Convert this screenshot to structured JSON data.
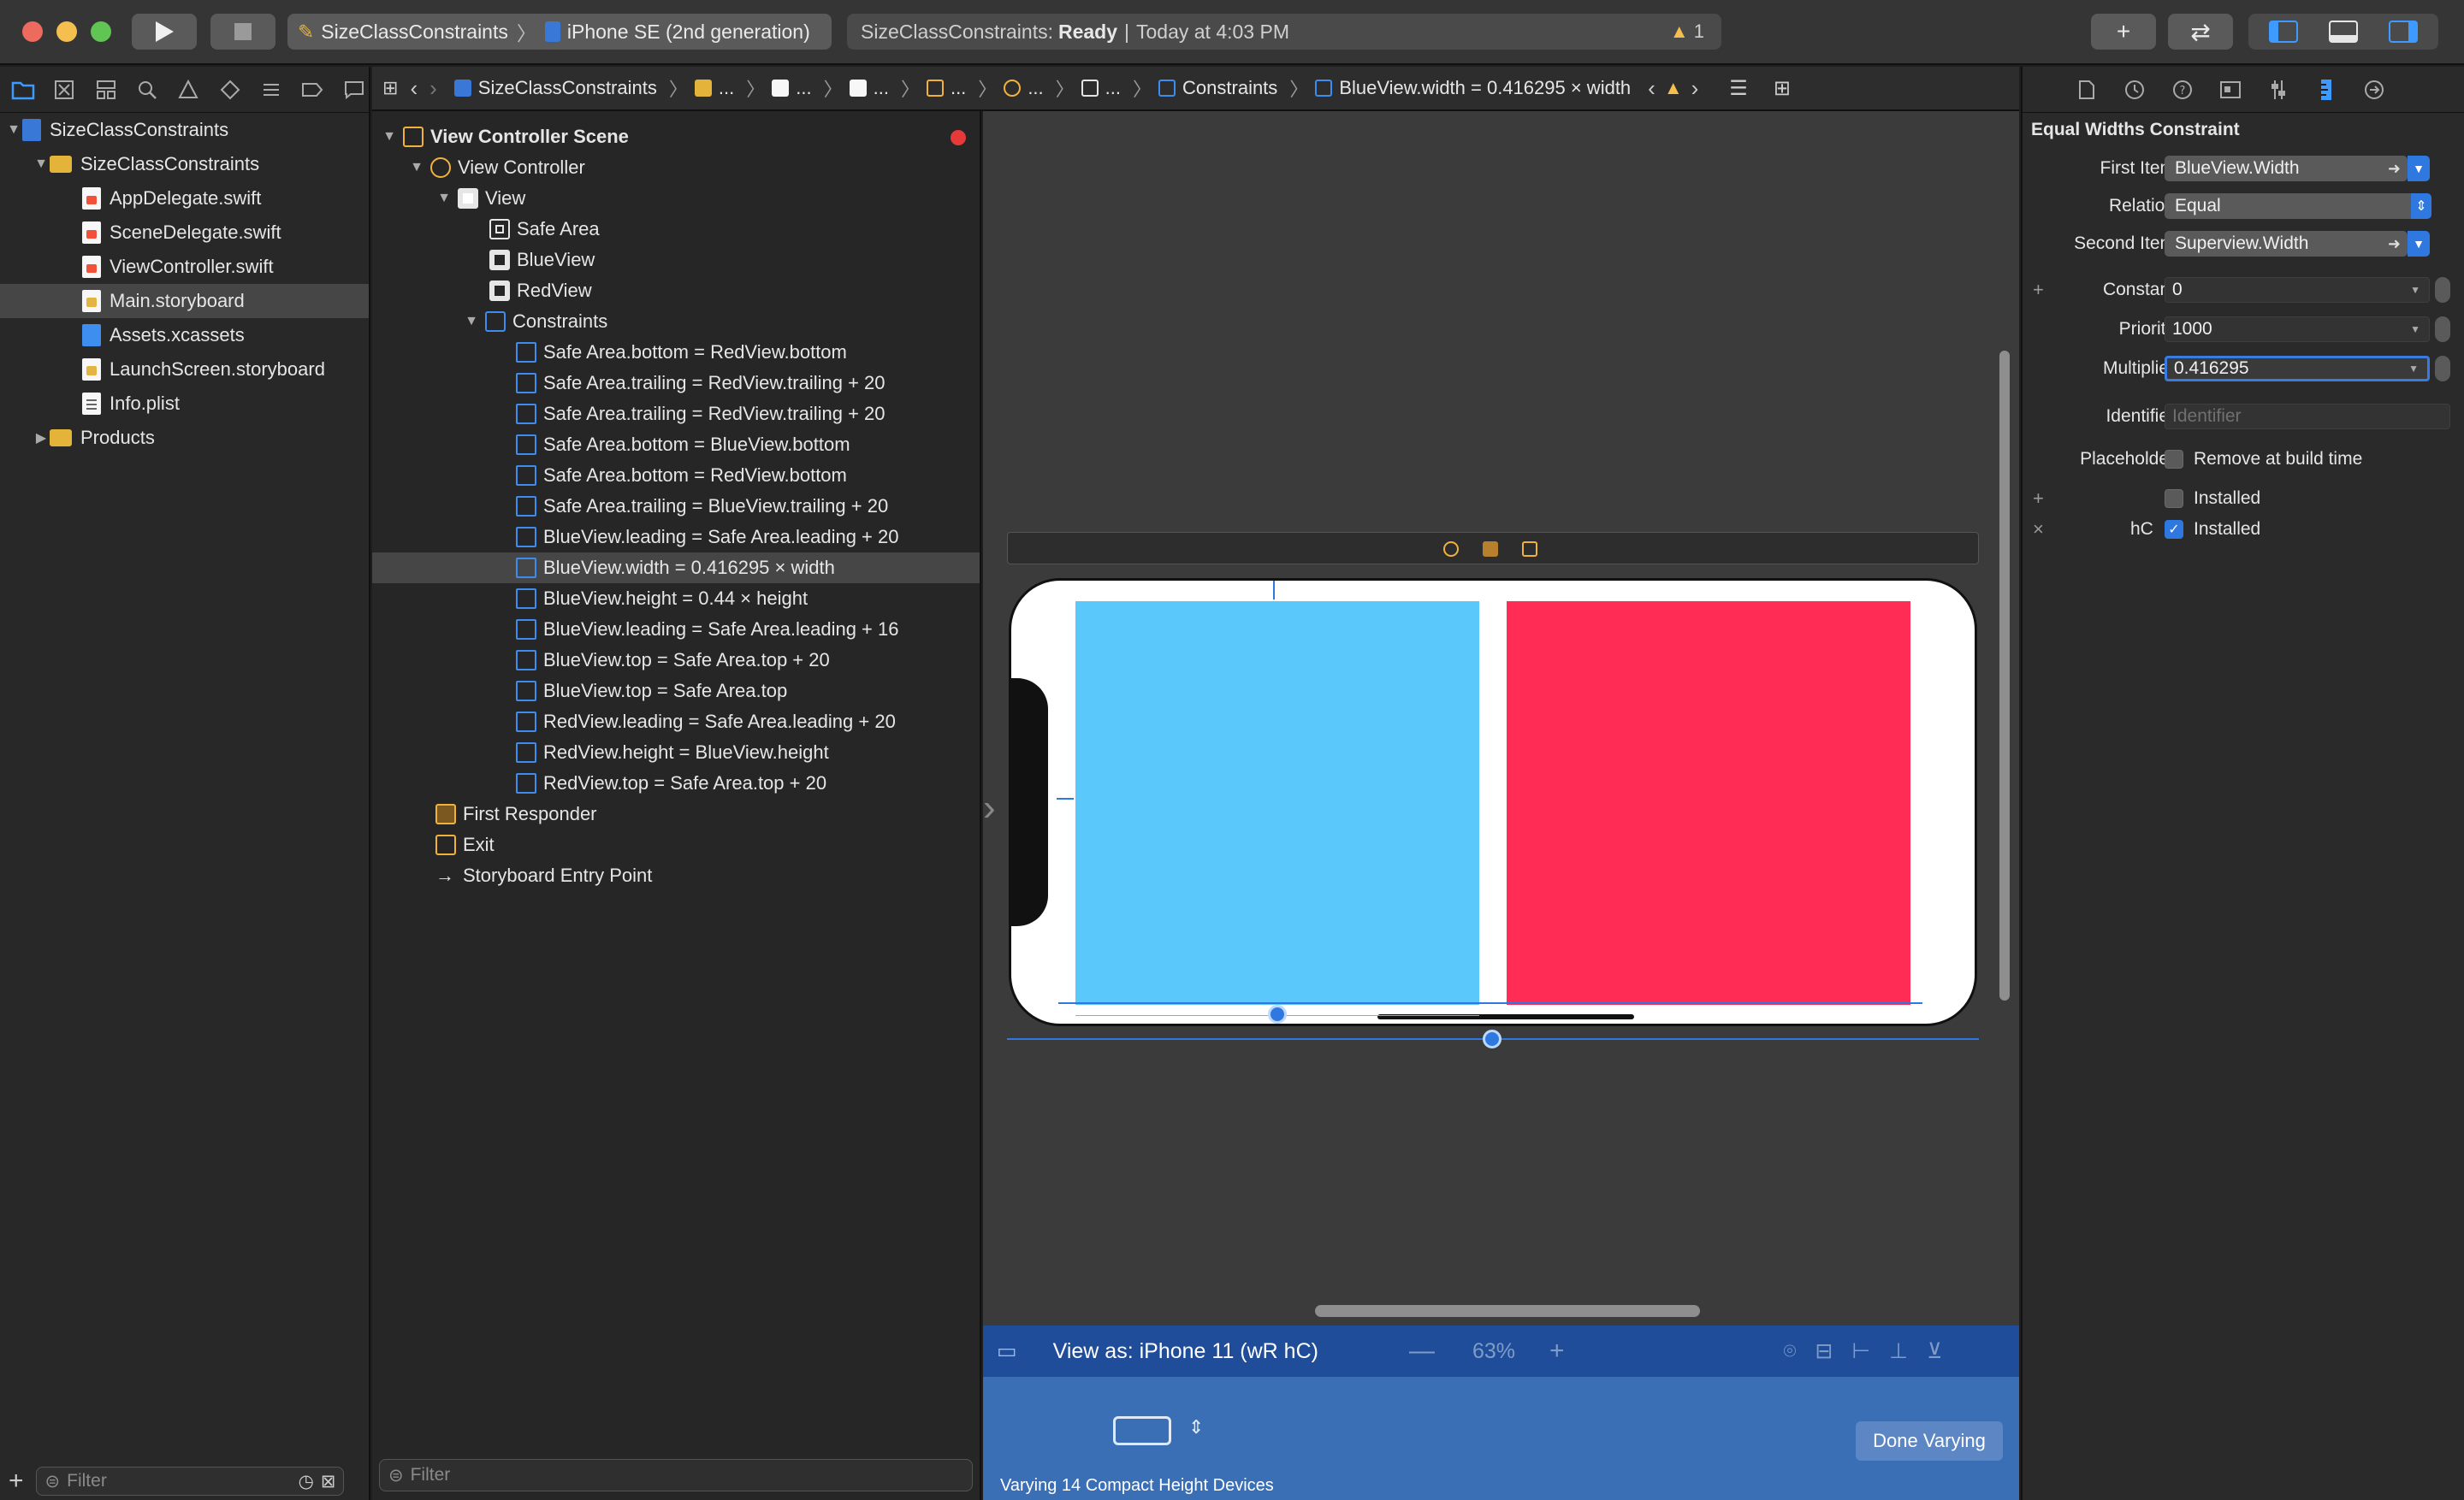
{
  "toolbar": {
    "scheme_project": "SizeClassConstraints",
    "scheme_device": "iPhone SE (2nd generation)",
    "activity_project": "SizeClassConstraints:",
    "activity_status": "Ready",
    "activity_time": "Today at 4:03 PM",
    "warning_count": "1"
  },
  "navigator": {
    "items": [
      {
        "label": "SizeClassConstraints",
        "icon": "project-icon"
      },
      {
        "label": "SizeClassConstraints",
        "icon": "folder-icon"
      },
      {
        "label": "AppDelegate.swift",
        "icon": "swift-file-icon"
      },
      {
        "label": "SceneDelegate.swift",
        "icon": "swift-file-icon"
      },
      {
        "label": "ViewController.swift",
        "icon": "swift-file-icon"
      },
      {
        "label": "Main.storyboard",
        "icon": "storyboard-file-icon"
      },
      {
        "label": "Assets.xcassets",
        "icon": "assets-icon"
      },
      {
        "label": "LaunchScreen.storyboard",
        "icon": "storyboard-file-icon"
      },
      {
        "label": "Info.plist",
        "icon": "plist-file-icon"
      },
      {
        "label": "Products",
        "icon": "folder-icon"
      }
    ],
    "filter_placeholder": "Filter"
  },
  "jumpbar": {
    "project": "SizeClassConstraints",
    "ellipsis": "...",
    "constraints": "Constraints",
    "current": "BlueView.width = 0.416295 × width"
  },
  "outline": {
    "scene": "View Controller Scene",
    "view_controller": "View Controller",
    "view": "View",
    "safe_area": "Safe Area",
    "blue_view": "BlueView",
    "red_view": "RedView",
    "constraints_group": "Constraints",
    "constraints": [
      "Safe Area.bottom = RedView.bottom",
      "Safe Area.trailing = RedView.trailing + 20",
      "Safe Area.trailing = RedView.trailing + 20",
      "Safe Area.bottom = BlueView.bottom",
      "Safe Area.bottom = RedView.bottom",
      "Safe Area.trailing = BlueView.trailing + 20",
      "BlueView.leading = Safe Area.leading + 20",
      "BlueView.width = 0.416295 × width",
      "BlueView.height = 0.44 × height",
      "BlueView.leading = Safe Area.leading + 16",
      "BlueView.top = Safe Area.top + 20",
      "BlueView.top = Safe Area.top",
      "RedView.leading = Safe Area.leading + 20",
      "RedView.height = BlueView.height",
      "RedView.top = Safe Area.top + 20"
    ],
    "first_responder": "First Responder",
    "exit": "Exit",
    "entry_point": "Storyboard Entry Point",
    "filter_placeholder": "Filter"
  },
  "canvas": {
    "view_as": "View as: iPhone 11 (wR hC)",
    "zoom": "63%",
    "done_varying": "Done Varying",
    "varying_text": "Varying 14 Compact Height Devices",
    "blue_view_color": "#5ac8fa",
    "red_view_color": "#ff2d55"
  },
  "inspector": {
    "title": "Equal Widths Constraint",
    "first_item_label": "First Item",
    "first_item_value": "BlueView.Width",
    "relation_label": "Relation",
    "relation_value": "Equal",
    "second_item_label": "Second Item",
    "second_item_value": "Superview.Width",
    "constant_label": "Constant",
    "constant_value": "0",
    "priority_label": "Priority",
    "priority_value": "1000",
    "multiplier_label": "Multiplier",
    "multiplier_value": "0.416295",
    "identifier_label": "Identifier",
    "identifier_placeholder": "Identifier",
    "placeholder_label": "Placeholder",
    "placeholder_check": "Remove at build time",
    "installed_label": "Installed",
    "installed_variant_label": "hC",
    "installed_variant_check": "Installed"
  }
}
